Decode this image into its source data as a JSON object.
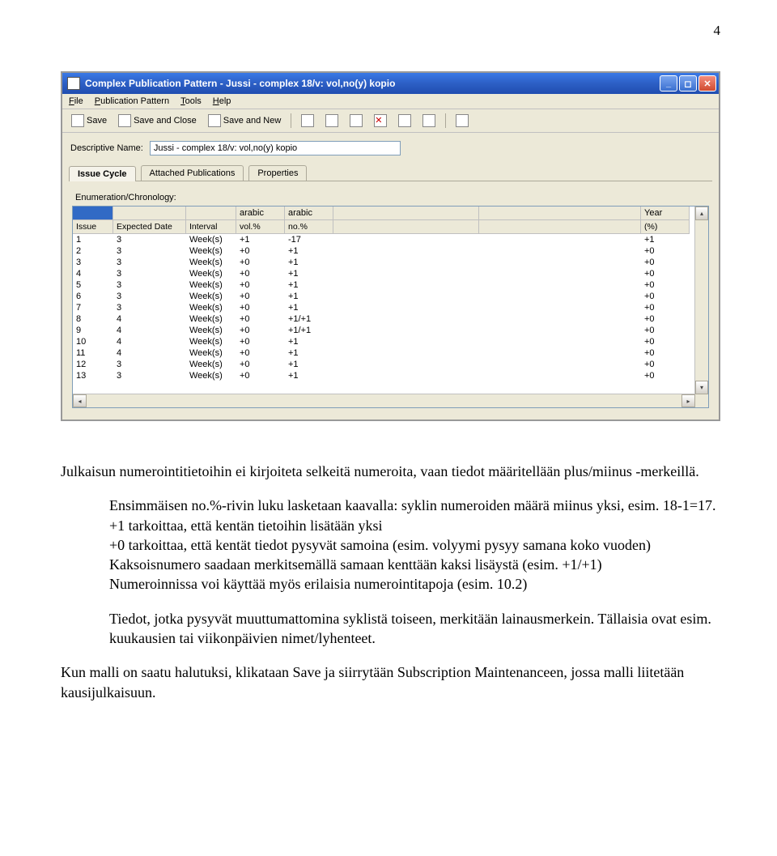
{
  "page_number": "4",
  "window": {
    "title": "Complex Publication Pattern - Jussi - complex 18/v: vol,no(y) kopio"
  },
  "menubar": {
    "file": "File",
    "publication_pattern": "Publication Pattern",
    "tools": "Tools",
    "help": "Help"
  },
  "toolbar": {
    "save": "Save",
    "save_close": "Save and Close",
    "save_new": "Save and New"
  },
  "form": {
    "descriptive_name_label": "Descriptive Name:",
    "descriptive_name_value": "Jussi - complex 18/v: vol,no(y) kopio"
  },
  "tabs": {
    "issue_cycle": "Issue Cycle",
    "attached": "Attached Publications",
    "properties": "Properties"
  },
  "panel": {
    "enum_chron_label": "Enumeration/Chronology:"
  },
  "grid": {
    "header_top": {
      "c3": "arabic",
      "c4": "arabic",
      "c7": "Year"
    },
    "header_sub": {
      "c0": "Issue",
      "c1": "Expected Date",
      "c2": "Interval",
      "c3": "vol.%",
      "c4": "no.%",
      "c5": "",
      "c6": "",
      "c7": "(%)"
    },
    "rows": [
      {
        "issue": "1",
        "expected": "3",
        "interval": "Week(s)",
        "vol": "+1",
        "no": "-17",
        "c5": "",
        "c6": "",
        "year": "+1"
      },
      {
        "issue": "2",
        "expected": "3",
        "interval": "Week(s)",
        "vol": "+0",
        "no": "+1",
        "c5": "",
        "c6": "",
        "year": "+0"
      },
      {
        "issue": "3",
        "expected": "3",
        "interval": "Week(s)",
        "vol": "+0",
        "no": "+1",
        "c5": "",
        "c6": "",
        "year": "+0"
      },
      {
        "issue": "4",
        "expected": "3",
        "interval": "Week(s)",
        "vol": "+0",
        "no": "+1",
        "c5": "",
        "c6": "",
        "year": "+0"
      },
      {
        "issue": "5",
        "expected": "3",
        "interval": "Week(s)",
        "vol": "+0",
        "no": "+1",
        "c5": "",
        "c6": "",
        "year": "+0"
      },
      {
        "issue": "6",
        "expected": "3",
        "interval": "Week(s)",
        "vol": "+0",
        "no": "+1",
        "c5": "",
        "c6": "",
        "year": "+0"
      },
      {
        "issue": "7",
        "expected": "3",
        "interval": "Week(s)",
        "vol": "+0",
        "no": "+1",
        "c5": "",
        "c6": "",
        "year": "+0"
      },
      {
        "issue": "8",
        "expected": "4",
        "interval": "Week(s)",
        "vol": "+0",
        "no": "+1/+1",
        "c5": "",
        "c6": "",
        "year": "+0"
      },
      {
        "issue": "9",
        "expected": "4",
        "interval": "Week(s)",
        "vol": "+0",
        "no": "+1/+1",
        "c5": "",
        "c6": "",
        "year": "+0"
      },
      {
        "issue": "10",
        "expected": "4",
        "interval": "Week(s)",
        "vol": "+0",
        "no": "+1",
        "c5": "",
        "c6": "",
        "year": "+0"
      },
      {
        "issue": "11",
        "expected": "4",
        "interval": "Week(s)",
        "vol": "+0",
        "no": "+1",
        "c5": "",
        "c6": "",
        "year": "+0"
      },
      {
        "issue": "12",
        "expected": "3",
        "interval": "Week(s)",
        "vol": "+0",
        "no": "+1",
        "c5": "",
        "c6": "",
        "year": "+0"
      },
      {
        "issue": "13",
        "expected": "3",
        "interval": "Week(s)",
        "vol": "+0",
        "no": "+1",
        "c5": "",
        "c6": "",
        "year": "+0"
      }
    ]
  },
  "prose": {
    "p1": "Julkaisun numerointitietoihin ei kirjoiteta selkeitä numeroita, vaan tiedot määritellään plus/miinus -merkeillä.",
    "p2a": "Ensimmäisen no.%-rivin luku lasketaan kaavalla: syklin numeroiden määrä miinus yksi, esim. 18-1=17.",
    "p2b": "+1 tarkoittaa, että kentän tietoihin lisätään yksi",
    "p2c": "+0 tarkoittaa, että kentät tiedot pysyvät samoina (esim. volyymi pysyy samana koko vuoden)",
    "p2d": "Kaksoisnumero saadaan merkitsemällä samaan kenttään kaksi lisäystä (esim. +1/+1)",
    "p2e": "Numeroinnissa voi käyttää myös erilaisia numerointitapoja (esim. 10.2)",
    "p3": "Tiedot, jotka pysyvät muuttumattomina syklistä toiseen, merkitään lainausmerkein. Tällaisia ovat esim. kuukausien tai viikonpäivien nimet/lyhenteet.",
    "p4": "Kun malli on saatu halutuksi, klikataan Save ja siirrytään Subscription Maintenanceen, jossa malli liitetään kausijulkaisuun."
  }
}
